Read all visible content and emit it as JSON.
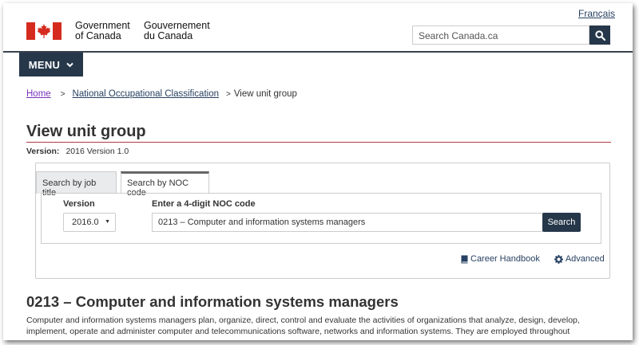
{
  "header": {
    "language_toggle": "Français",
    "signature_en": [
      "Government",
      "of Canada"
    ],
    "signature_fr": [
      "Gouvernement",
      "du Canada"
    ],
    "search_placeholder": "Search Canada.ca",
    "menu_label": "MENU"
  },
  "breadcrumb": {
    "items": [
      "Home",
      "National Occupational Classification"
    ],
    "current": "View unit group"
  },
  "page": {
    "title": "View unit group",
    "version_label": "Version:",
    "version_value": "2016 Version 1.0"
  },
  "search_panel": {
    "tabs": [
      {
        "label": "Search by job title",
        "active": false
      },
      {
        "label": "Search by NOC code",
        "active": true
      }
    ],
    "version_field_label": "Version",
    "version_selected": "2016.0",
    "noc_field_label": "Enter a 4-digit NOC code",
    "noc_value": "0213 – Computer and information systems managers",
    "search_button": "Search",
    "links": [
      "Career Handbook",
      "Advanced"
    ]
  },
  "unit_group": {
    "title": "0213 – Computer and information systems managers",
    "description": "Computer and information systems managers plan, organize, direct, control and evaluate the activities of organizations that analyze, design, develop, implement, operate and administer computer and telecommunications software, networks and information systems. They are employed throughout"
  },
  "colors": {
    "primary_dark": "#26374a",
    "link": "#284162",
    "visited_link": "#7834bc",
    "flag_red": "#d52b1e",
    "title_rule": "#af3c43"
  },
  "icons": [
    "maple-leaf-flag-icon",
    "search-icon",
    "chevron-down-icon",
    "book-icon",
    "gear-icon"
  ]
}
